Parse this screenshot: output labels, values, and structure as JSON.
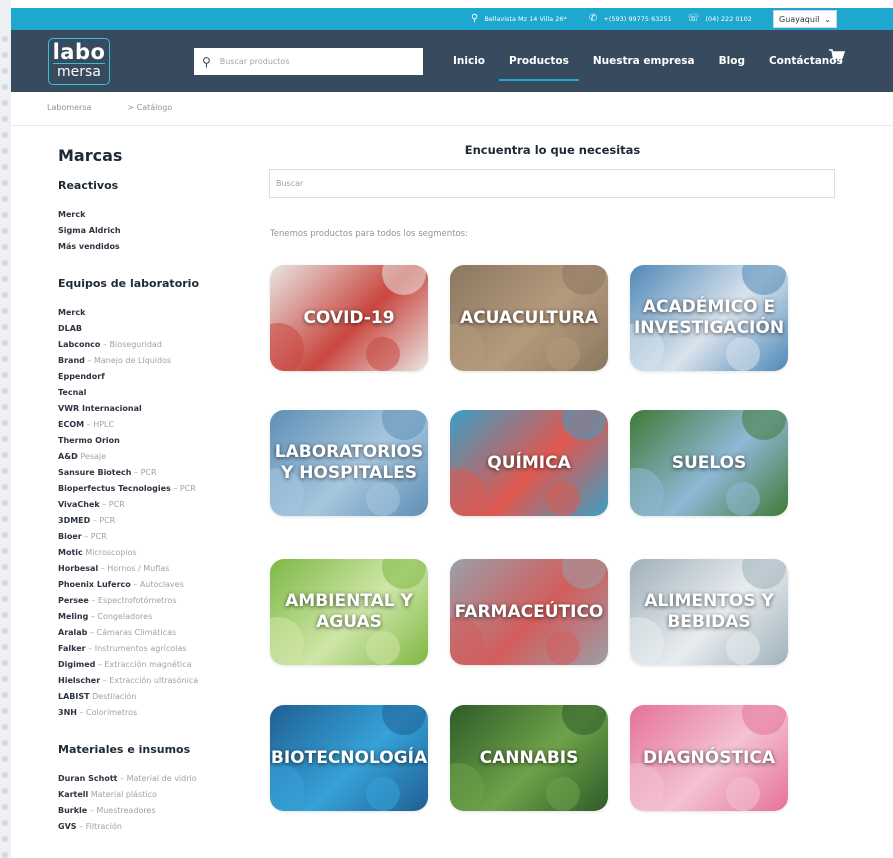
{
  "topbar": {
    "address": "Bellavista Mz 14 Villa 26*",
    "whatsapp": "+(593) 99775 63251",
    "phone": "(04) 222 0102",
    "city_selected": "Guayaquil"
  },
  "header": {
    "logo_line1": "labo",
    "logo_line2": "mersa",
    "search_placeholder": "Buscar productos",
    "nav": [
      "Inicio",
      "Productos",
      "Nuestra empresa",
      "Blog",
      "Contáctanos"
    ],
    "active_nav": "Productos"
  },
  "breadcrumb": {
    "home": "Labomersa",
    "current": "> Catálogo"
  },
  "sidebar": {
    "title": "Marcas",
    "sections": [
      {
        "heading": "Reactivos",
        "items": [
          {
            "brand": "Merck",
            "desc": ""
          },
          {
            "brand": "Sigma Aldrich",
            "desc": ""
          },
          {
            "brand": "Más vendidos",
            "desc": ""
          }
        ]
      },
      {
        "heading": "Equipos de laboratorio",
        "items": [
          {
            "brand": "Merck",
            "desc": ""
          },
          {
            "brand": "DLAB",
            "desc": ""
          },
          {
            "brand": "Labconco",
            "desc": " – Bioseguridad"
          },
          {
            "brand": "Brand",
            "desc": " – Manejo de Líquidos"
          },
          {
            "brand": "Eppendorf",
            "desc": ""
          },
          {
            "brand": "Tecnal",
            "desc": ""
          },
          {
            "brand": "VWR Internacional",
            "desc": ""
          },
          {
            "brand": "ECOM",
            "desc": " – HPLC"
          },
          {
            "brand": "Thermo Orion",
            "desc": ""
          },
          {
            "brand": "A&D",
            "desc": " Pesaje"
          },
          {
            "brand": "Sansure Biotech",
            "desc": " – PCR"
          },
          {
            "brand": "Bioperfectus Tecnologies",
            "desc": " – PCR"
          },
          {
            "brand": "VivaChek",
            "desc": " – PCR"
          },
          {
            "brand": "3DMED",
            "desc": " – PCR"
          },
          {
            "brand": "Bioer",
            "desc": " – PCR"
          },
          {
            "brand": "Motic",
            "desc": " Microscopios"
          },
          {
            "brand": "Horbesal",
            "desc": " – Hornos / Muflas"
          },
          {
            "brand": "Phoenix Luferco",
            "desc": " – Autoclaves"
          },
          {
            "brand": "Persee",
            "desc": " – Espectrofotómetros"
          },
          {
            "brand": "Meling",
            "desc": " – Congeladores"
          },
          {
            "brand": "Aralab",
            "desc": " – Cámaras Climáticas"
          },
          {
            "brand": "Falker",
            "desc": " – Instrumentos agrícolas"
          },
          {
            "brand": "Digimed",
            "desc": " – Extracción magnética"
          },
          {
            "brand": "Hielscher",
            "desc": " – Extracción ultrasónica"
          },
          {
            "brand": "LABIST",
            "desc": " Destilación"
          },
          {
            "brand": "3NH",
            "desc": " – Colorímetros"
          }
        ]
      },
      {
        "heading": "Materiales e insumos",
        "items": [
          {
            "brand": "Duran Schott",
            "desc": " – Material de vidrio"
          },
          {
            "brand": "Kartell",
            "desc": " Material plástico"
          },
          {
            "brand": "Burkle",
            "desc": " – Muestreadores"
          },
          {
            "brand": "GVS",
            "desc": " – Filtración"
          }
        ]
      }
    ]
  },
  "main": {
    "title": "Encuentra lo que necesitas",
    "search_placeholder": "Buscar",
    "subtitle": "Tenemos productos para todos los segmentos:",
    "tiles": [
      {
        "label": "COVID-19",
        "bg": "#e9e6e4",
        "accent": "#c9473f"
      },
      {
        "label": "ACUACULTURA",
        "bg": "#8a7760",
        "accent": "#b59a7c"
      },
      {
        "label": "ACADÉMICO E INVESTIGACIÓN",
        "bg": "#4f88b7",
        "accent": "#d9e3ec"
      },
      {
        "label": "LABORATORIOS Y HOSPITALES",
        "bg": "#5e8fb5",
        "accent": "#a7c6de"
      },
      {
        "label": "QUÍMICA",
        "bg": "#3a9fc6",
        "accent": "#e0584f"
      },
      {
        "label": "SUELOS",
        "bg": "#3f7a36",
        "accent": "#8fb8d6"
      },
      {
        "label": "AMBIENTAL Y AGUAS",
        "bg": "#7eb843",
        "accent": "#cfe6a8"
      },
      {
        "label": "FARMACEÚTICO",
        "bg": "#9aa0a8",
        "accent": "#d35c5c"
      },
      {
        "label": "ALIMENTOS Y BEBIDAS",
        "bg": "#9fb0bb",
        "accent": "#e8ecef"
      },
      {
        "label": "BIOTECNOLOGÍA",
        "bg": "#1f5f93",
        "accent": "#36a2d8"
      },
      {
        "label": "CANNABIS",
        "bg": "#2e5b28",
        "accent": "#6ea24a"
      },
      {
        "label": "DIAGNÓSTICA",
        "bg": "#e6719a",
        "accent": "#f3c2d3"
      }
    ]
  }
}
